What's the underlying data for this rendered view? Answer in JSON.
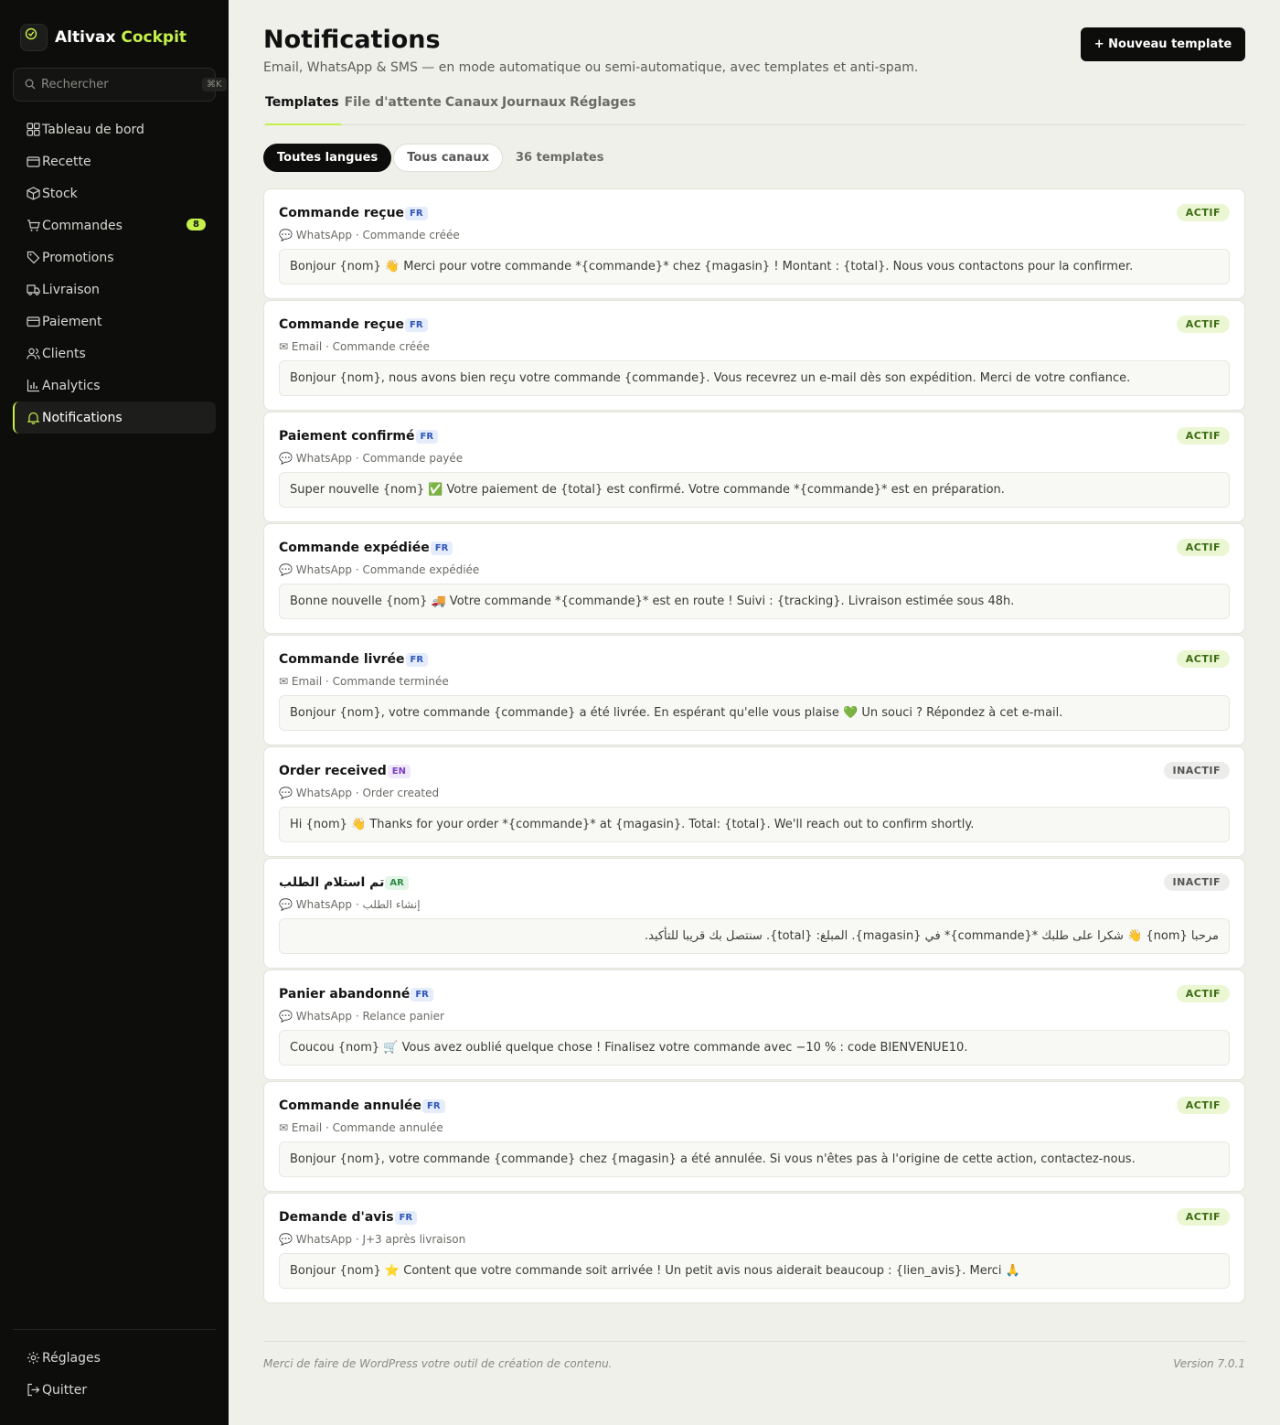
{
  "brand": {
    "name": "Altivax",
    "accent": "Cockpit",
    "accent_color": "#c5f04a",
    "logo_icon": "gauge-icon"
  },
  "search": {
    "placeholder": "Rechercher",
    "shortcut": "⌘K"
  },
  "nav": {
    "items": [
      {
        "label": "Tableau de bord",
        "icon": "dashboard-icon"
      },
      {
        "label": "Recette",
        "icon": "wallet-icon"
      },
      {
        "label": "Stock",
        "icon": "box-icon"
      },
      {
        "label": "Commandes",
        "icon": "cart-icon",
        "badge": "8"
      },
      {
        "label": "Promotions",
        "icon": "tag-icon"
      },
      {
        "label": "Livraison",
        "icon": "truck-icon"
      },
      {
        "label": "Paiement",
        "icon": "card-icon"
      },
      {
        "label": "Clients",
        "icon": "users-icon"
      },
      {
        "label": "Analytics",
        "icon": "chart-icon"
      },
      {
        "label": "Notifications",
        "icon": "bell-icon",
        "active": true
      }
    ],
    "bottom": [
      {
        "label": "Réglages",
        "icon": "gear-icon"
      },
      {
        "label": "Quitter",
        "icon": "logout-icon"
      }
    ]
  },
  "header": {
    "title": "Notifications",
    "subtitle": "Email, WhatsApp & SMS — en mode automatique ou semi-automatique, avec templates et anti-spam.",
    "new_button": "+ Nouveau template"
  },
  "tabs": [
    "Templates",
    "File d'attente",
    "Canaux",
    "Journaux",
    "Réglages"
  ],
  "filters": {
    "language": "Toutes langues",
    "channel": "Tous canaux",
    "count": "36 templates"
  },
  "templates": [
    {
      "title": "Commande reçue",
      "lang": "FR",
      "status": "ACTIF",
      "channel_icon": "💬",
      "meta": "WhatsApp · Commande créée",
      "body": "Bonjour {nom} 👋 Merci pour votre commande *{commande}* chez {magasin} ! Montant : {total}. Nous vous contactons pour la confirmer."
    },
    {
      "title": "Commande reçue",
      "lang": "FR",
      "status": "ACTIF",
      "channel_icon": "✉",
      "meta": "Email · Commande créée",
      "body": "Bonjour {nom}, nous avons bien reçu votre commande {commande}. Vous recevrez un e-mail dès son expédition. Merci de votre confiance."
    },
    {
      "title": "Paiement confirmé",
      "lang": "FR",
      "status": "ACTIF",
      "channel_icon": "💬",
      "meta": "WhatsApp · Commande payée",
      "body": "Super nouvelle {nom} ✅ Votre paiement de {total} est confirmé. Votre commande *{commande}* est en préparation."
    },
    {
      "title": "Commande expédiée",
      "lang": "FR",
      "status": "ACTIF",
      "channel_icon": "💬",
      "meta": "WhatsApp · Commande expédiée",
      "body": "Bonne nouvelle {nom} 🚚 Votre commande *{commande}* est en route ! Suivi : {tracking}. Livraison estimée sous 48h."
    },
    {
      "title": "Commande livrée",
      "lang": "FR",
      "status": "ACTIF",
      "channel_icon": "✉",
      "meta": "Email · Commande terminée",
      "body": "Bonjour {nom}, votre commande {commande} a été livrée. En espérant qu'elle vous plaise 💚 Un souci ? Répondez à cet e-mail."
    },
    {
      "title": "Order received",
      "lang": "EN",
      "status": "INACTIF",
      "channel_icon": "💬",
      "meta": "WhatsApp · Order created",
      "body": "Hi {nom} 👋 Thanks for your order *{commande}* at {magasin}. Total: {total}. We'll reach out to confirm shortly."
    },
    {
      "title": "تم استلام الطلب",
      "lang": "AR",
      "status": "INACTIF",
      "channel_icon": "💬",
      "meta": "WhatsApp · إنشاء الطلب",
      "body": "مرحبا {nom} 👋 شكرا على طلبك *{commande}* في {magasin}. المبلغ: {total}. سنتصل بك قريبا للتأكيد.",
      "rtl": true
    },
    {
      "title": "Panier abandonné",
      "lang": "FR",
      "status": "ACTIF",
      "channel_icon": "💬",
      "meta": "WhatsApp · Relance panier",
      "body": "Coucou {nom} 🛒 Vous avez oublié quelque chose ! Finalisez votre commande avec −10 % : code BIENVENUE10."
    },
    {
      "title": "Commande annulée",
      "lang": "FR",
      "status": "ACTIF",
      "channel_icon": "✉",
      "meta": "Email · Commande annulée",
      "body": "Bonjour {nom}, votre commande {commande} chez {magasin} a été annulée. Si vous n'êtes pas à l'origine de cette action, contactez-nous."
    },
    {
      "title": "Demande d'avis",
      "lang": "FR",
      "status": "ACTIF",
      "channel_icon": "💬",
      "meta": "WhatsApp · J+3 après livraison",
      "body": "Bonjour {nom} ⭐ Content que votre commande soit arrivée ! Un petit avis nous aiderait beaucoup : {lien_avis}. Merci 🙏"
    }
  ],
  "footer": {
    "left": "Merci de faire de WordPress votre outil de création de contenu.",
    "right": "Version 7.0.1"
  }
}
